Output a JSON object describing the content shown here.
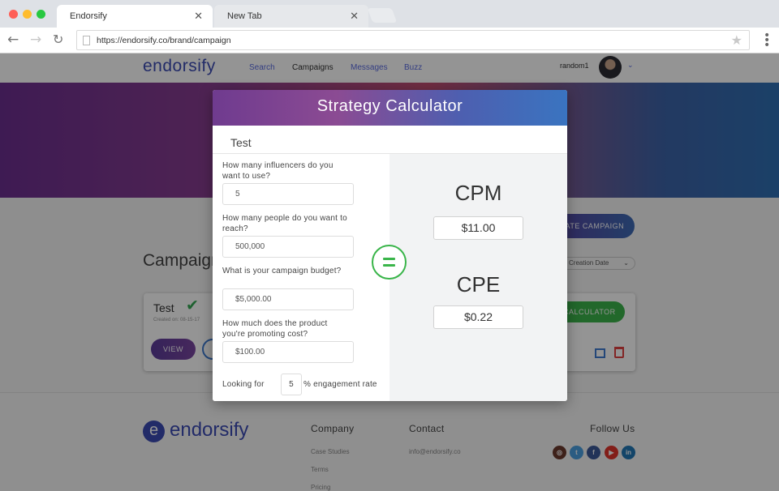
{
  "browser": {
    "tabs": [
      {
        "label": "Endorsify",
        "active": true
      },
      {
        "label": "New Tab",
        "active": false
      }
    ],
    "url": "https://endorsify.co/brand/campaign"
  },
  "site": {
    "logo": "endorsify",
    "nav": [
      {
        "label": "Search",
        "active": false
      },
      {
        "label": "Campaigns",
        "active": true
      },
      {
        "label": "Messages",
        "active": false
      },
      {
        "label": "Buzz",
        "active": false
      }
    ],
    "user": "random1",
    "create_button": "CREATE CAMPAIGN",
    "campaigns_title": "Campaigns",
    "sort_value": "Creation Date",
    "card": {
      "title": "Test",
      "status": "A",
      "created": "Created on: 08-15-17",
      "view_label": "VIEW",
      "calculator_label": "CALCULATOR"
    },
    "footer": {
      "logo": "endorsify",
      "company_head": "Company",
      "company_links": [
        "Case Studies",
        "Terms",
        "Pricing"
      ],
      "contact_head": "Contact",
      "contact_email": "info@endorsify.co",
      "follow_head": "Follow Us",
      "social": [
        {
          "name": "instagram-icon",
          "glyph": "◎",
          "color": "#6b3a2e"
        },
        {
          "name": "twitter-icon",
          "glyph": "t",
          "color": "#4a9fe0"
        },
        {
          "name": "facebook-icon",
          "glyph": "f",
          "color": "#3b5998"
        },
        {
          "name": "youtube-icon",
          "glyph": "▶",
          "color": "#e0352b"
        },
        {
          "name": "linkedin-icon",
          "glyph": "in",
          "color": "#2277b5"
        }
      ]
    }
  },
  "modal": {
    "title": "Strategy Calculator",
    "campaign_name": "Test",
    "questions": [
      {
        "label": "How many influencers do you want to use?",
        "value": "5"
      },
      {
        "label": "How many people do you want to reach?",
        "value": "500,000"
      },
      {
        "label": "What is your campaign budget?",
        "value": "$5,000.00"
      },
      {
        "label": "How much does the product you're promoting cost?",
        "value": "$100.00"
      }
    ],
    "engagement": {
      "prefix": "Looking for",
      "value": "5",
      "suffix": "% engagement rate"
    },
    "results": {
      "cpm_label": "CPM",
      "cpm_value": "$11.00",
      "cpe_label": "CPE",
      "cpe_value": "$0.22"
    }
  }
}
